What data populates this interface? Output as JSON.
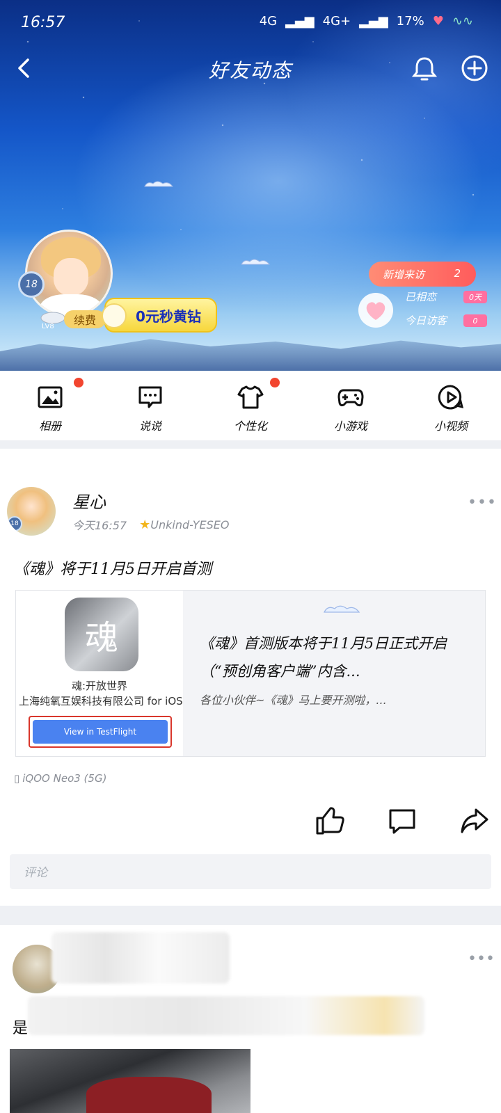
{
  "status_bar": {
    "time": "16:57",
    "network1": "4G",
    "network2": "4G+",
    "battery": "17%"
  },
  "nav": {
    "title": "好友动态"
  },
  "profile": {
    "age_badge": "18",
    "level": "LV8",
    "renew_label": "续费",
    "promo_label": "0元秒黄钻",
    "new_visits_label": "新增来访",
    "new_visits_count": "2",
    "liked_label": "已相恋",
    "liked_value": "0天",
    "today_visitors_label": "今日访客",
    "today_visitors_value": "0"
  },
  "iconbar": [
    {
      "label": "相册",
      "icon": "photo-album-icon",
      "dot": true
    },
    {
      "label": "说说",
      "icon": "chat-bubble-icon",
      "dot": false
    },
    {
      "label": "个性化",
      "icon": "tshirt-icon",
      "dot": true
    },
    {
      "label": "小游戏",
      "icon": "gamepad-icon",
      "dot": false
    },
    {
      "label": "小视频",
      "icon": "play-video-icon",
      "dot": false
    }
  ],
  "post1": {
    "author": "星心",
    "time": "今天16:57",
    "tag": "Unkind-YESEO",
    "text": "《魂》将于11月5日开启首测",
    "card": {
      "app_name": "魂:开放世界",
      "company": "上海纯氧互娱科技有限公司 for iOS",
      "button": "View in TestFlight",
      "title": "《魂》首测版本将于11月5日正式开启（“预创角客户端”内含...",
      "desc": "各位小伙伴~《魂》马上要开测啦，..."
    },
    "device": "iQOO Neo3 (5G)",
    "comment_placeholder": "评论"
  },
  "post2": {
    "text_start": "是"
  }
}
